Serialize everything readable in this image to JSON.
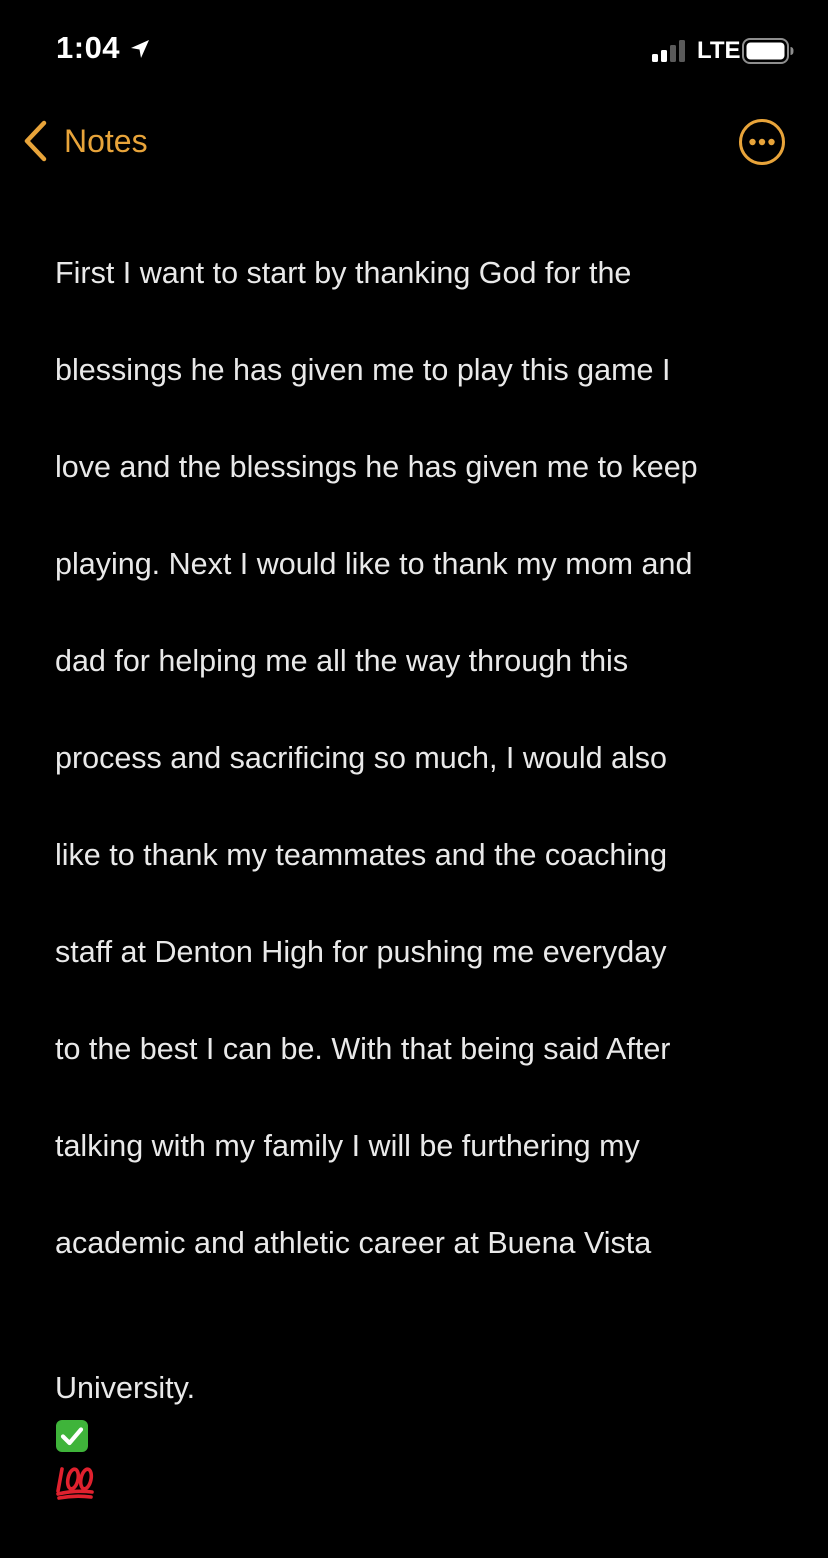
{
  "status_bar": {
    "time": "1:04",
    "carrier": "LTE",
    "icons": [
      "location-arrow-icon",
      "cellular-signal-icon",
      "battery-icon"
    ]
  },
  "nav": {
    "back_label": "Notes",
    "back_icon": "chevron-left-icon",
    "more_icon": "ellipsis-circle-icon"
  },
  "note": {
    "lines": [
      "First I want to start by thanking God for the",
      "blessings he has given me to play this game I",
      "love and the blessings he has given me to keep",
      "playing. Next I would like to thank my mom and",
      "dad for helping me all the way through this",
      "process and sacrificing so much, I would also",
      "like to thank my teammates and the coaching",
      "staff at Denton High for pushing me everyday",
      "to the best I can be. With that being said After",
      "talking with my family I will be furthering my",
      "academic and athletic career at Buena Vista",
      "University."
    ],
    "emojis": [
      "check-mark-button-emoji",
      "hundred-points-emoji"
    ]
  },
  "colors": {
    "background": "#000000",
    "accent": "#e8a43a",
    "text": "#e9e9e9",
    "status_text": "#ffffff"
  }
}
